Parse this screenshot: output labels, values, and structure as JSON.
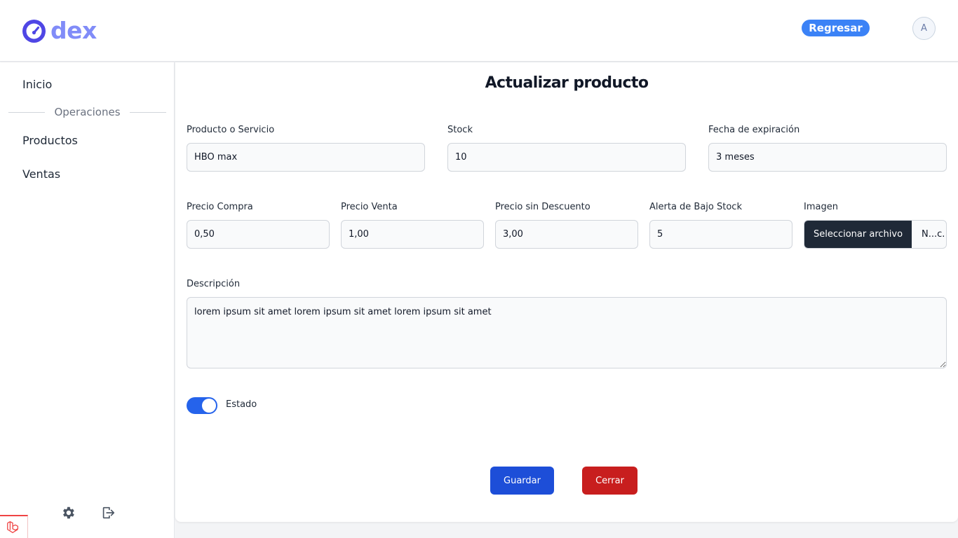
{
  "header": {
    "logo_text": "dex",
    "back_button": "Regresar",
    "avatar_initial": "A",
    "accent_color": "#818cf8",
    "button_color": "#3b82f6"
  },
  "sidebar": {
    "items": [
      {
        "label": "Inicio"
      },
      {
        "label": "Productos"
      },
      {
        "label": "Ventas"
      }
    ],
    "section_label": "Operaciones",
    "bottom_icons": [
      "gear-icon",
      "logout-icon"
    ]
  },
  "form": {
    "title": "Actualizar producto",
    "product_label": "Producto o Servicio",
    "product_value": "HBO max",
    "stock_label": "Stock",
    "stock_value": "10",
    "expiration_label": "Fecha de expiración",
    "expiration_value": "3 meses",
    "buy_price_label": "Precio Compra",
    "buy_price_value": "0,50",
    "sell_price_label": "Precio Venta",
    "sell_price_value": "1,00",
    "list_price_label": "Precio sin Descuento",
    "list_price_value": "3,00",
    "low_stock_label": "Alerta de Bajo Stock",
    "low_stock_value": "5",
    "image_label": "Imagen",
    "file_button": "Seleccionar archivo",
    "file_name": "N...c.",
    "description_label": "Descripción",
    "description_value": "lorem ipsum sit amet lorem ipsum sit amet lorem ipsum sit amet",
    "status_label": "Estado",
    "status_on": true,
    "save_button": "Guardar",
    "close_button": "Cerrar",
    "save_color": "#1d4ed8",
    "close_color": "#c81e1e"
  }
}
